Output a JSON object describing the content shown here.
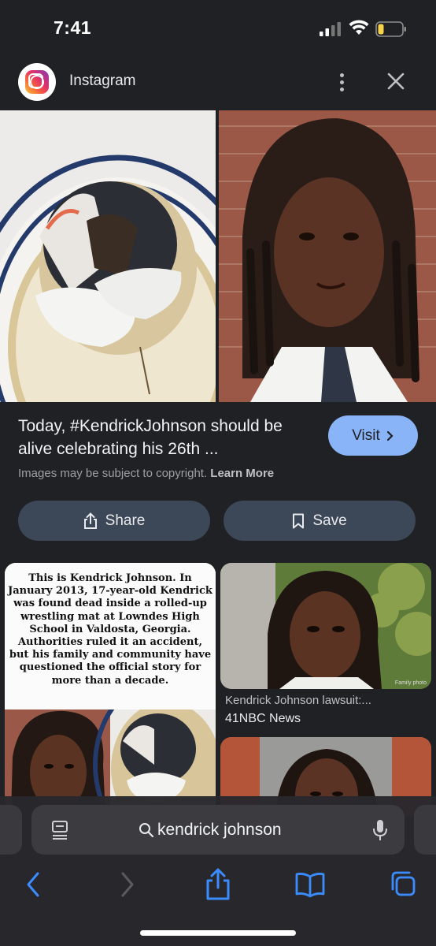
{
  "status": {
    "time": "7:41"
  },
  "header": {
    "title": "Instagram"
  },
  "result": {
    "title": "Today, #KendrickJohnson should be alive celebrating his 26th ...",
    "visit_label": "Visit",
    "copyright_text": "Images may be subject to copyright.",
    "learn_more": "Learn More",
    "share_label": "Share",
    "save_label": "Save"
  },
  "related": {
    "quote_text": "This is Kendrick Johnson. In January 2013, 17-year-old Kendrick was found dead inside a rolled-up wrestling mat at Lowndes High School in Valdosta, Georgia. Authorities ruled it an accident, but his family and community have questioned the official story for more than a decade.",
    "card2_caption": "Kendrick Johnson lawsuit:...",
    "card2_source": "41NBC News",
    "card2_watermark": "Family photo"
  },
  "browser": {
    "search_query": "kendrick johnson"
  },
  "colors": {
    "accent": "#8ab4f8",
    "button_bg": "#3c4757",
    "page_bg": "#202124"
  },
  "icons": [
    "instagram-logo",
    "more-vert-icon",
    "close-icon",
    "chevron-right-icon",
    "share-icon",
    "bookmark-icon",
    "tabs-icon",
    "search-icon",
    "mic-icon",
    "back-icon",
    "forward-icon",
    "book-icon",
    "tab-switcher-icon"
  ]
}
